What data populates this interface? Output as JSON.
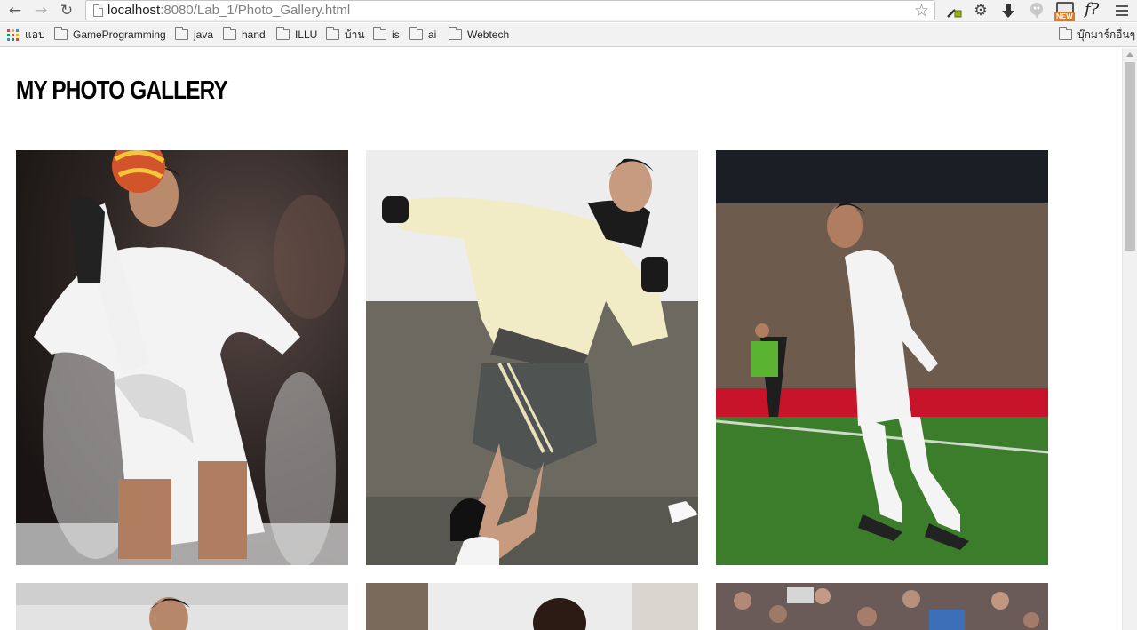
{
  "browser": {
    "url_host": "localhost",
    "url_path": ":8080/Lab_1/Photo_Gallery.html",
    "extensions": [
      "eyedropper-icon",
      "settings-gear-icon",
      "download-icon",
      "balloon-icon",
      "new-badge-icon",
      "fx-icon",
      "chrome-menu-icon"
    ],
    "new_badge": "NEW",
    "fx_label": "f?"
  },
  "bookmarks": {
    "apps_label": "แอป",
    "items": [
      {
        "label": "GameProgramming"
      },
      {
        "label": "java"
      },
      {
        "label": "hand"
      },
      {
        "label": "ILLU"
      },
      {
        "label": "บ้าน"
      },
      {
        "label": "is"
      },
      {
        "label": "ai"
      },
      {
        "label": "Webtech"
      }
    ],
    "other_label": "บุ๊กมาร์กอื่นๆ"
  },
  "page": {
    "title": "MY PHOTO GALLERY",
    "photos": [
      {
        "alt": "Player in white kit kicking a ball"
      },
      {
        "alt": "Player in cream training top running"
      },
      {
        "alt": "Player in white kit on pitch with crowd"
      },
      {
        "alt": "Player in white kit"
      },
      {
        "alt": "Player in indoor setting"
      },
      {
        "alt": "Stadium crowd"
      }
    ]
  }
}
